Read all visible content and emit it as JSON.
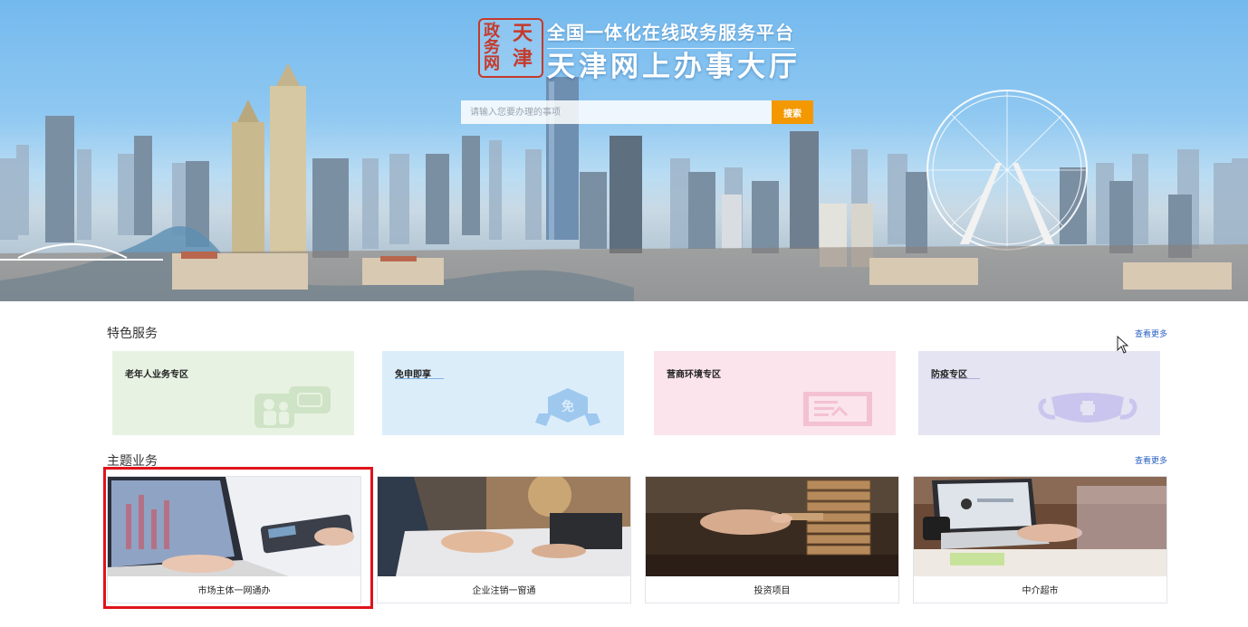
{
  "header": {
    "seal_chars": [
      "天",
      "津",
      "政",
      "务",
      "网"
    ],
    "subtitle": "全国一体化在线政务服务平台",
    "title": "天津网上办事大厅",
    "search": {
      "placeholder": "请输入您要办理的事项",
      "button_label": "搜索"
    }
  },
  "featured": {
    "title": "特色服务",
    "more_label": "查看更多",
    "cards": [
      {
        "label": "老年人业务专区",
        "icon": "elderly-icon",
        "bg": "#e8f2e2"
      },
      {
        "label": "免申即享",
        "icon": "exempt-badge-icon",
        "badge_text": "免",
        "bg": "#dcedfa"
      },
      {
        "label": "营商环境专区",
        "icon": "certificate-icon",
        "bg": "#fbe4ec"
      },
      {
        "label": "防疫专区",
        "icon": "mask-icon",
        "bg": "#e4e4f2"
      }
    ]
  },
  "topics": {
    "title": "主题业务",
    "more_label": "查看更多",
    "cards": [
      {
        "label": "市场主体一网通办",
        "image": "laptop-calculator-photo"
      },
      {
        "label": "企业注销一窗通",
        "image": "business-handshake-photo"
      },
      {
        "label": "投资项目",
        "image": "jenga-blocks-photo"
      },
      {
        "label": "中介超市",
        "image": "laptop-desk-photo"
      }
    ]
  },
  "colors": {
    "accent": "#f39800",
    "link": "#2b62c4",
    "highlight": "#e0131b",
    "seal": "#c53a2b"
  }
}
